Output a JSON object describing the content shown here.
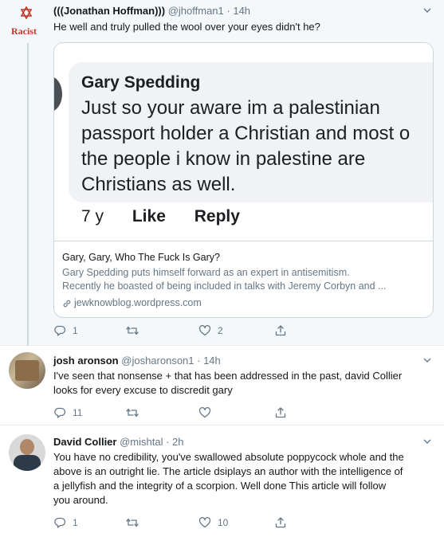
{
  "tweets": [
    {
      "name": "(((Jonathan Hoffman)))",
      "handle": "@jhoffman1",
      "time": "· 14h",
      "avatar_text": "Racist",
      "text": "He well and truly pulled the wool over your eyes didn't he?",
      "card": {
        "image": {
          "name": "Gary Spedding",
          "lines": [
            "Just so your aware im a palestinian",
            "passport holder a Christian and most o",
            "the people i know in palestine are",
            "Christians as well."
          ],
          "age": "7 y",
          "like": "Like",
          "reply": "Reply"
        },
        "title": "Gary, Gary, Who The Fuck Is Gary?",
        "description": "Gary Spedding puts himself forward as an expert in antisemitism. Recently he boasted of being included in talks with Jeremy Corbyn and ...",
        "description_line1": "Gary Spedding puts himself forward as an expert in antisemitism.",
        "description_line2": "Recently he boasted of being included in talks with Jeremy Corbyn and ...",
        "domain": "jewknowblog.wordpress.com"
      },
      "actions": {
        "reply_count": "1",
        "retweet_count": "",
        "like_count": "2"
      }
    },
    {
      "name": "josh aronson",
      "handle": "@josharonson1",
      "time": "· 14h",
      "text_line1": "I've seen that nonsense + that has been addressed in the past,  david Collier",
      "text_line2": "looks for every excuse to discredit gary",
      "actions": {
        "reply_count": "11",
        "retweet_count": "",
        "like_count": ""
      }
    },
    {
      "name": "David Collier",
      "handle": "@mishtal",
      "time": "· 2h",
      "text_line1": "You have no credibility, you've swallowed absolute poppycock whole and the",
      "text_line2": "above is an outright lie. The article dsiplays an author with the intelligence of",
      "text_line3": "a jellyfish and the integrity of a scorpion. Well done This article will follow",
      "text_line4": "you around.",
      "actions": {
        "reply_count": "1",
        "retweet_count": "",
        "like_count": "10"
      }
    }
  ],
  "colors": {
    "text": "#14171a",
    "secondary": "#657786",
    "border": "#e6ecf0",
    "highlight_bg": "#f5f8fa",
    "racist_red": "#c0392b"
  },
  "icons": [
    "reply-icon",
    "retweet-icon",
    "like-icon",
    "share-icon",
    "caret-down-icon",
    "link-icon"
  ]
}
